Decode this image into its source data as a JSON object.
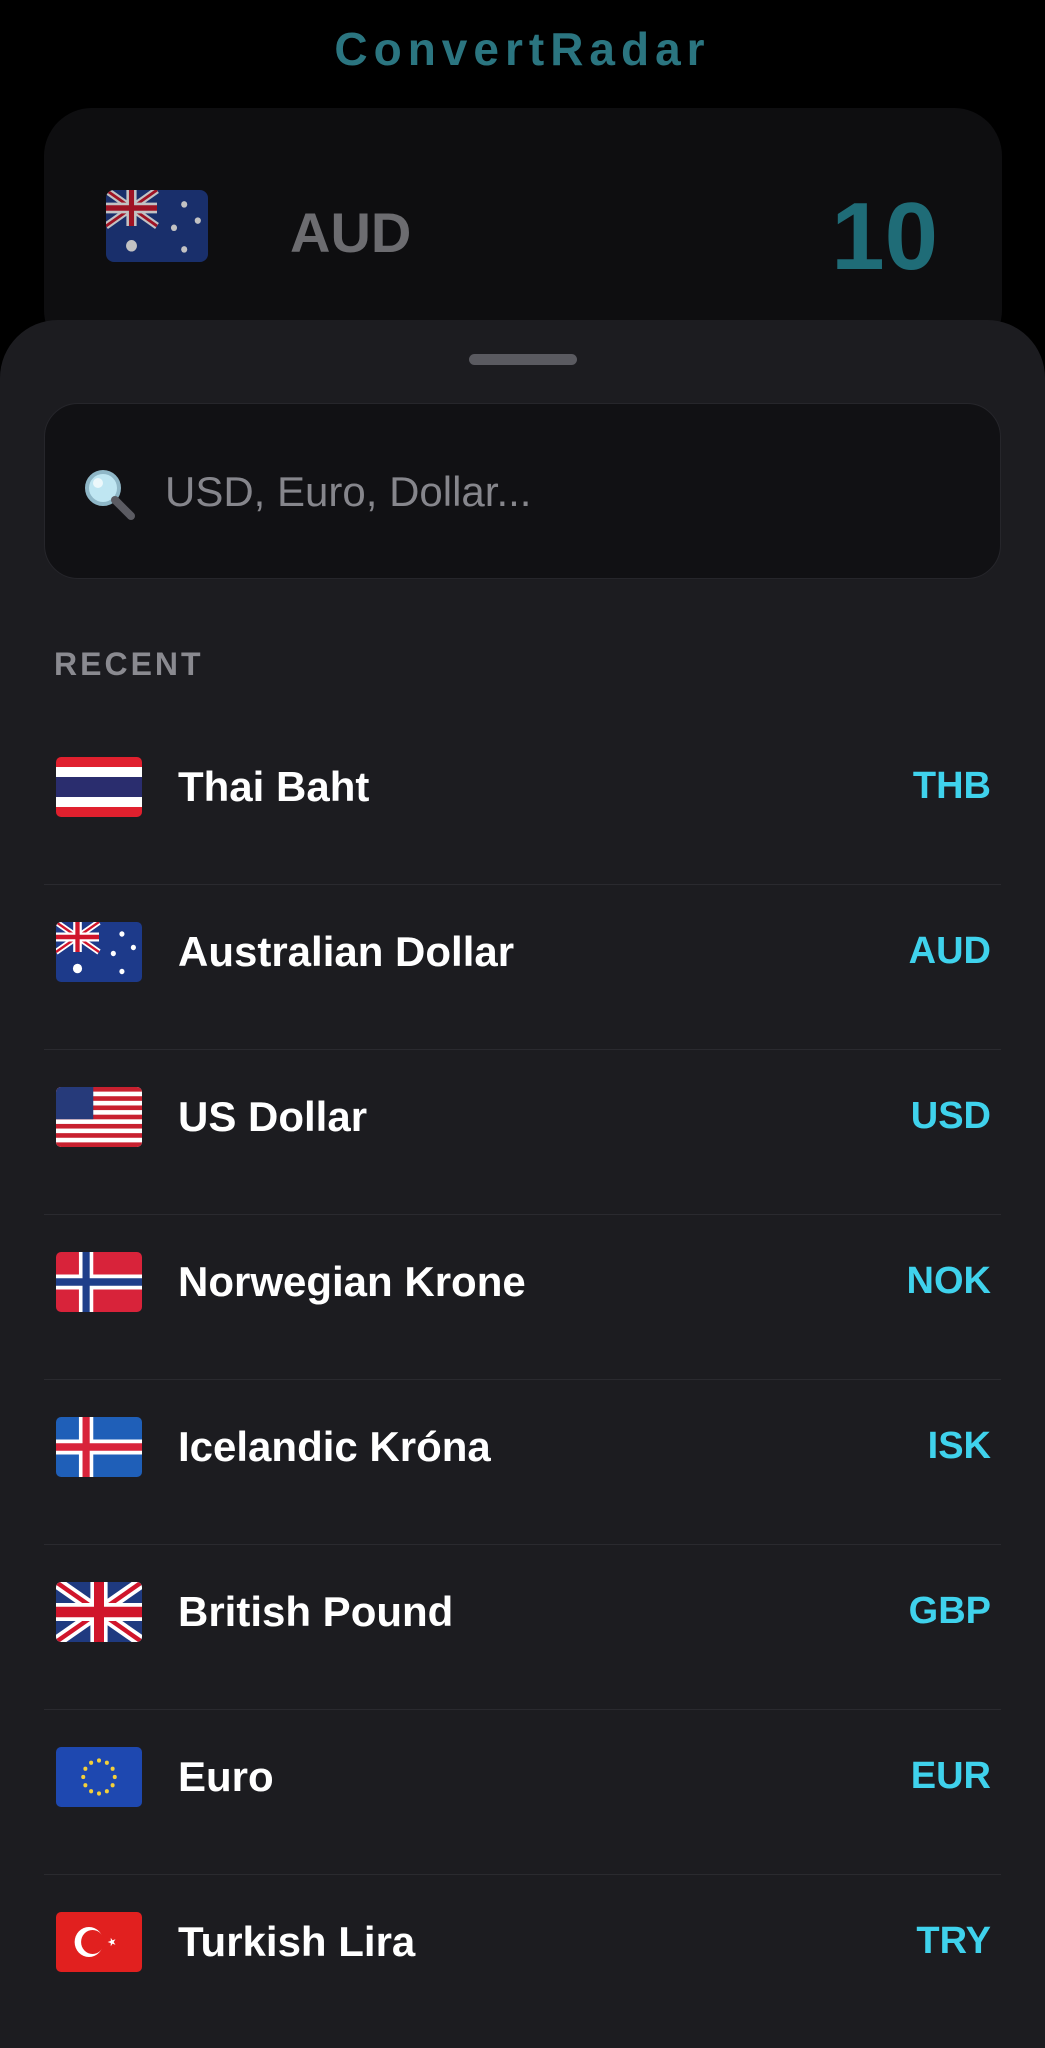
{
  "app": {
    "title": "ConvertRadar"
  },
  "converter": {
    "currency_code": "AUD",
    "flag_icon": "australia-flag-icon",
    "amount": "10"
  },
  "search": {
    "placeholder": "USD, Euro, Dollar...",
    "value": ""
  },
  "recent": {
    "label": "RECENT",
    "items": [
      {
        "name": "Thai Baht",
        "code": "THB",
        "flag": "thailand-flag-icon"
      },
      {
        "name": "Australian Dollar",
        "code": "AUD",
        "flag": "australia-flag-icon"
      },
      {
        "name": "US Dollar",
        "code": "USD",
        "flag": "usa-flag-icon"
      },
      {
        "name": "Norwegian Krone",
        "code": "NOK",
        "flag": "norway-flag-icon"
      },
      {
        "name": "Icelandic Króna",
        "code": "ISK",
        "flag": "iceland-flag-icon"
      },
      {
        "name": "British Pound",
        "code": "GBP",
        "flag": "uk-flag-icon"
      },
      {
        "name": "Euro",
        "code": "EUR",
        "flag": "eu-flag-icon"
      },
      {
        "name": "Turkish Lira",
        "code": "TRY",
        "flag": "turkey-flag-icon"
      }
    ]
  },
  "colors": {
    "accent": "#3fd2ec",
    "title": "#2b7580",
    "sheet_background": "#1c1c20",
    "background": "#000000"
  }
}
